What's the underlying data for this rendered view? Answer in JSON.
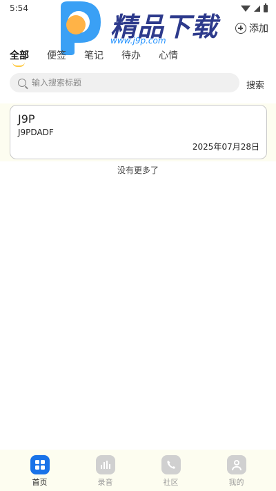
{
  "status": {
    "time": "5:54"
  },
  "watermark": {
    "text": "精品下载",
    "url": "www.j9p.com"
  },
  "header": {
    "add_label": "添加"
  },
  "tabs": [
    {
      "label": "全部",
      "active": true
    },
    {
      "label": "便签"
    },
    {
      "label": "笔记"
    },
    {
      "label": "待办"
    },
    {
      "label": "心情"
    }
  ],
  "search": {
    "placeholder": "输入搜索标题",
    "button_label": "搜索"
  },
  "notes": [
    {
      "title": "J9P",
      "content": "J9PDADF",
      "date": "2025年07月28日"
    }
  ],
  "list_footer": "没有更多了",
  "bottom_nav": [
    {
      "label": "首页",
      "icon": "home-grid-icon",
      "active": true
    },
    {
      "label": "录音",
      "icon": "audio-bars-icon"
    },
    {
      "label": "社区",
      "icon": "phone-icon"
    },
    {
      "label": "我的",
      "icon": "person-icon"
    }
  ],
  "colors": {
    "accent": "#1a73e8",
    "tab_indicator": "#ffc940",
    "band": "#fdfdf0"
  }
}
